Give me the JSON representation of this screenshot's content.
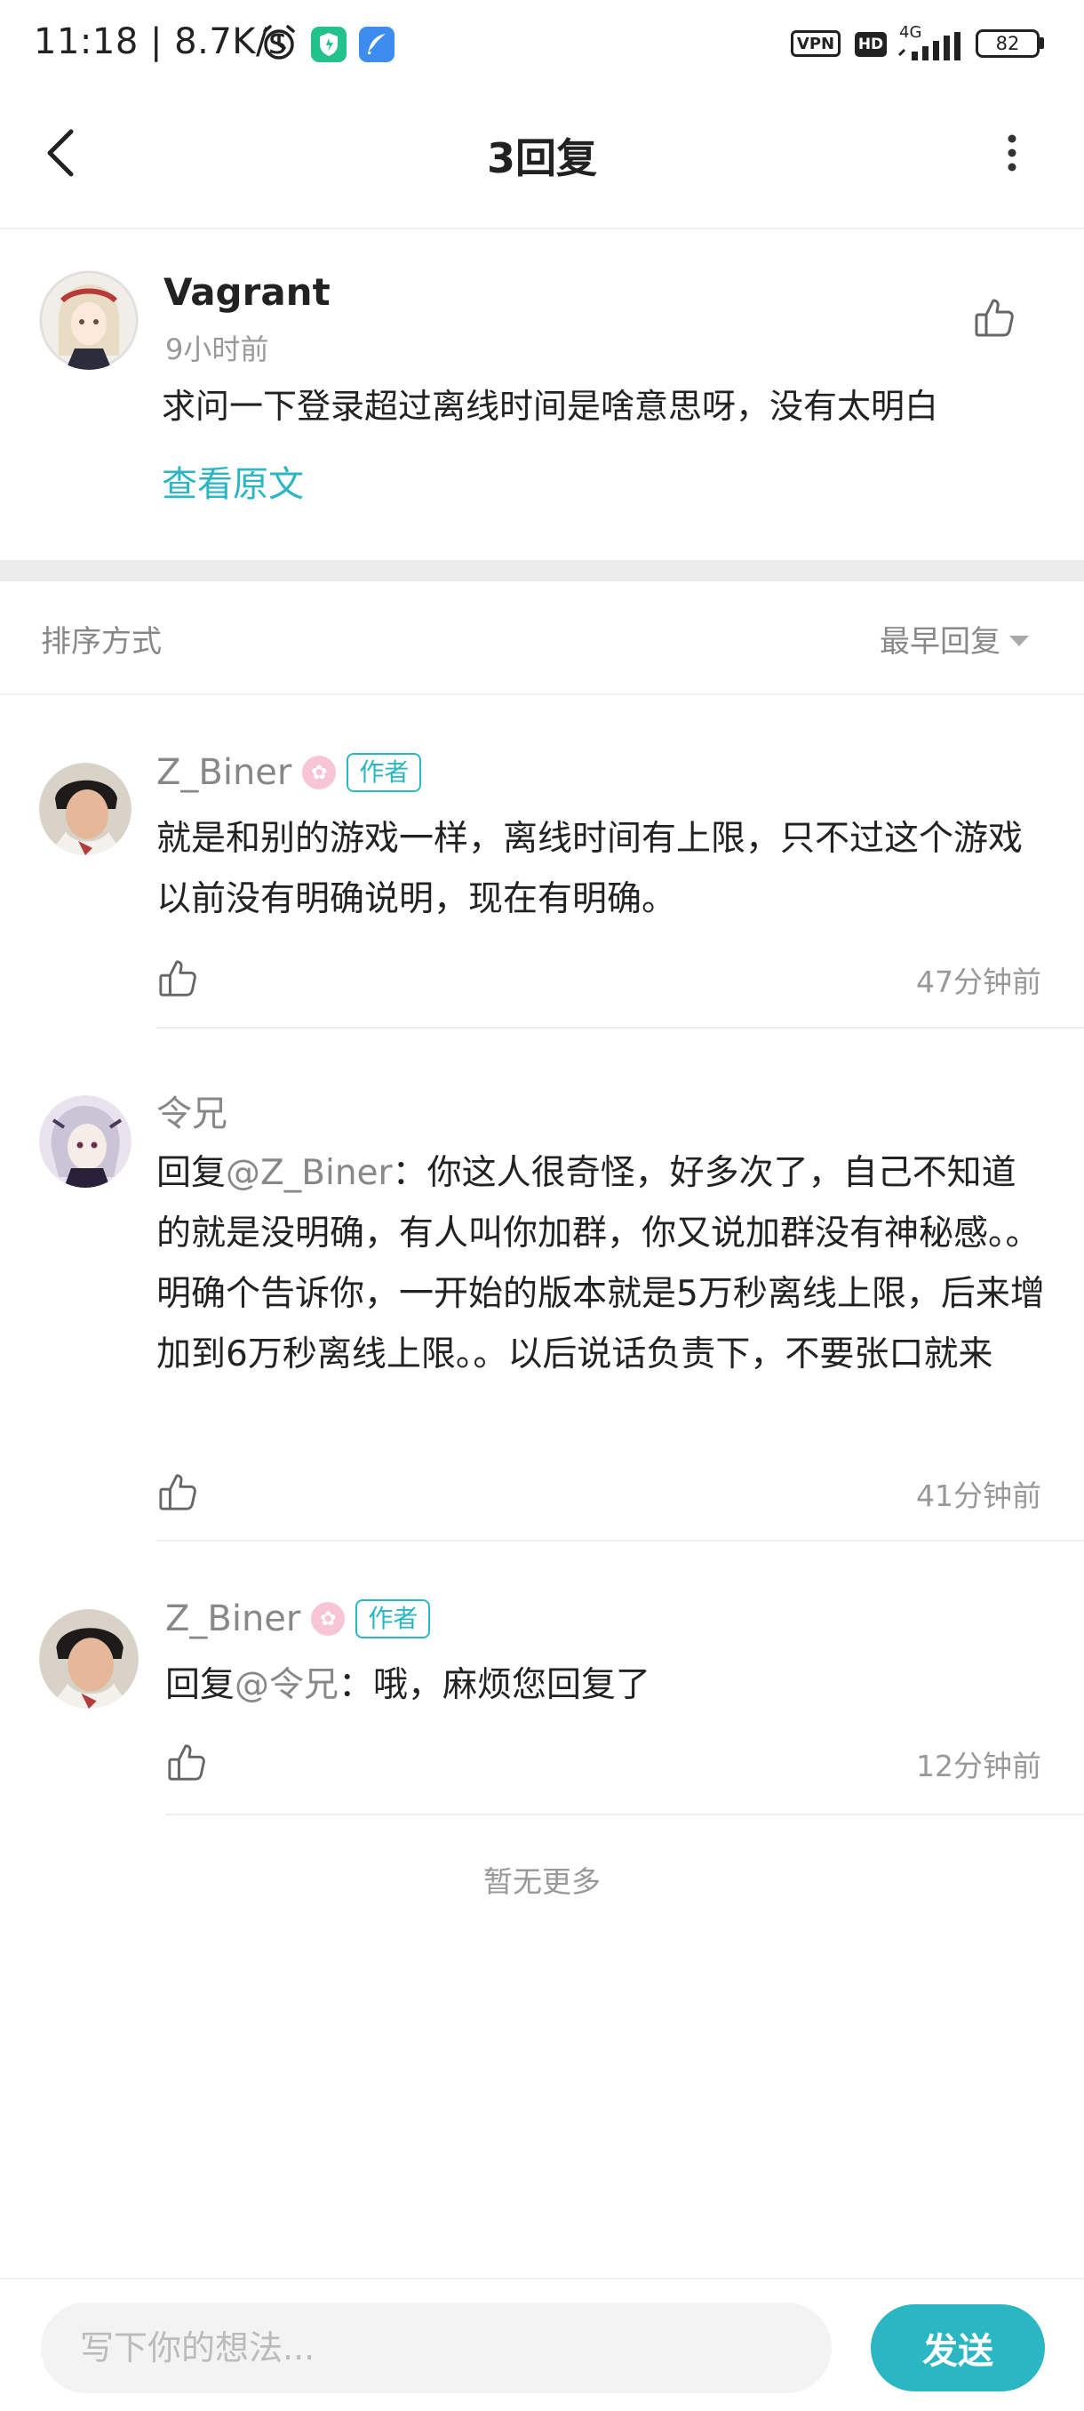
{
  "status_bar": {
    "time": "11:18 | 8.7K/s",
    "vpn": "VPN",
    "hd": "HD",
    "network": "4G",
    "battery": "82"
  },
  "header": {
    "title": "3回复"
  },
  "original": {
    "author": "Vagrant",
    "time": "9小时前",
    "content": "求问一下登录超过离线时间是啥意思呀，没有太明白",
    "view_original": "查看原文"
  },
  "sort": {
    "label": "排序方式",
    "selected": "最早回复"
  },
  "replies": [
    {
      "author": "Z_Biner",
      "badge": "作者",
      "text": "就是和别的游戏一样，离线时间有上限，只不过这个游戏以前没有明确说明，现在有明确。",
      "time": "47分钟前"
    },
    {
      "author": "令兄",
      "reply_prefix": "回复",
      "mention": "@Z_Biner",
      "text": "：你这人很奇怪，好多次了，自己不知道的就是没明确，有人叫你加群，你又说加群没有神秘感。。明确个告诉你，一开始的版本就是5万秒离线上限，后来增加到6万秒离线上限。。以后说话负责下，不要张口就来",
      "time": "41分钟前"
    },
    {
      "author": "Z_Biner",
      "badge": "作者",
      "reply_prefix": "回复",
      "mention": "@令兄",
      "text": "：哦，麻烦您回复了",
      "time": "12分钟前"
    }
  ],
  "no_more": "暂无更多",
  "bottom": {
    "placeholder": "写下你的想法...",
    "send": "发送"
  },
  "colors": {
    "accent": "#2bb6c3",
    "muted": "#888888",
    "divider": "#eeeeee"
  }
}
